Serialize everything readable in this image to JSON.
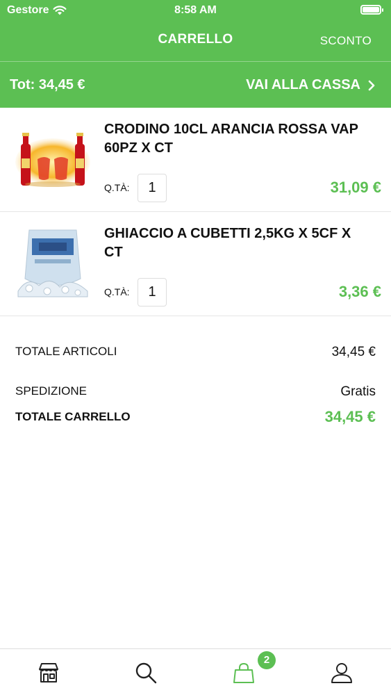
{
  "status_bar": {
    "carrier": "Gestore",
    "time": "8:58 AM"
  },
  "nav": {
    "title": "CARRELLO",
    "action": "SCONTO"
  },
  "total_bar": {
    "total": "Tot: 34,45 €",
    "checkout": "VAI ALLA CASSA"
  },
  "items": [
    {
      "name": "CRODINO 10CL ARANCIA ROSSA VAP 60PZ X CT",
      "qty_label": "Q.TÀ:",
      "qty": "1",
      "price": "31,09 €"
    },
    {
      "name": "GHIACCIO A CUBETTI 2,5KG X 5CF X CT",
      "qty_label": "Q.TÀ:",
      "qty": "1",
      "price": "3,36 €"
    }
  ],
  "summary": {
    "items_total_label": "TOTALE ARTICOLI",
    "items_total": "34,45 €",
    "shipping_label": "SPEDIZIONE",
    "shipping": "Gratis",
    "cart_total_label": "TOTALE CARRELLO",
    "cart_total": "34,45 €"
  },
  "tabbar": {
    "icons": [
      "store-icon",
      "search-icon",
      "shopping-bag-icon",
      "user-icon"
    ],
    "cart_badge": "2"
  },
  "colors": {
    "accent": "#5cbf53",
    "text": "#111111",
    "divider": "#e5e5e5"
  }
}
